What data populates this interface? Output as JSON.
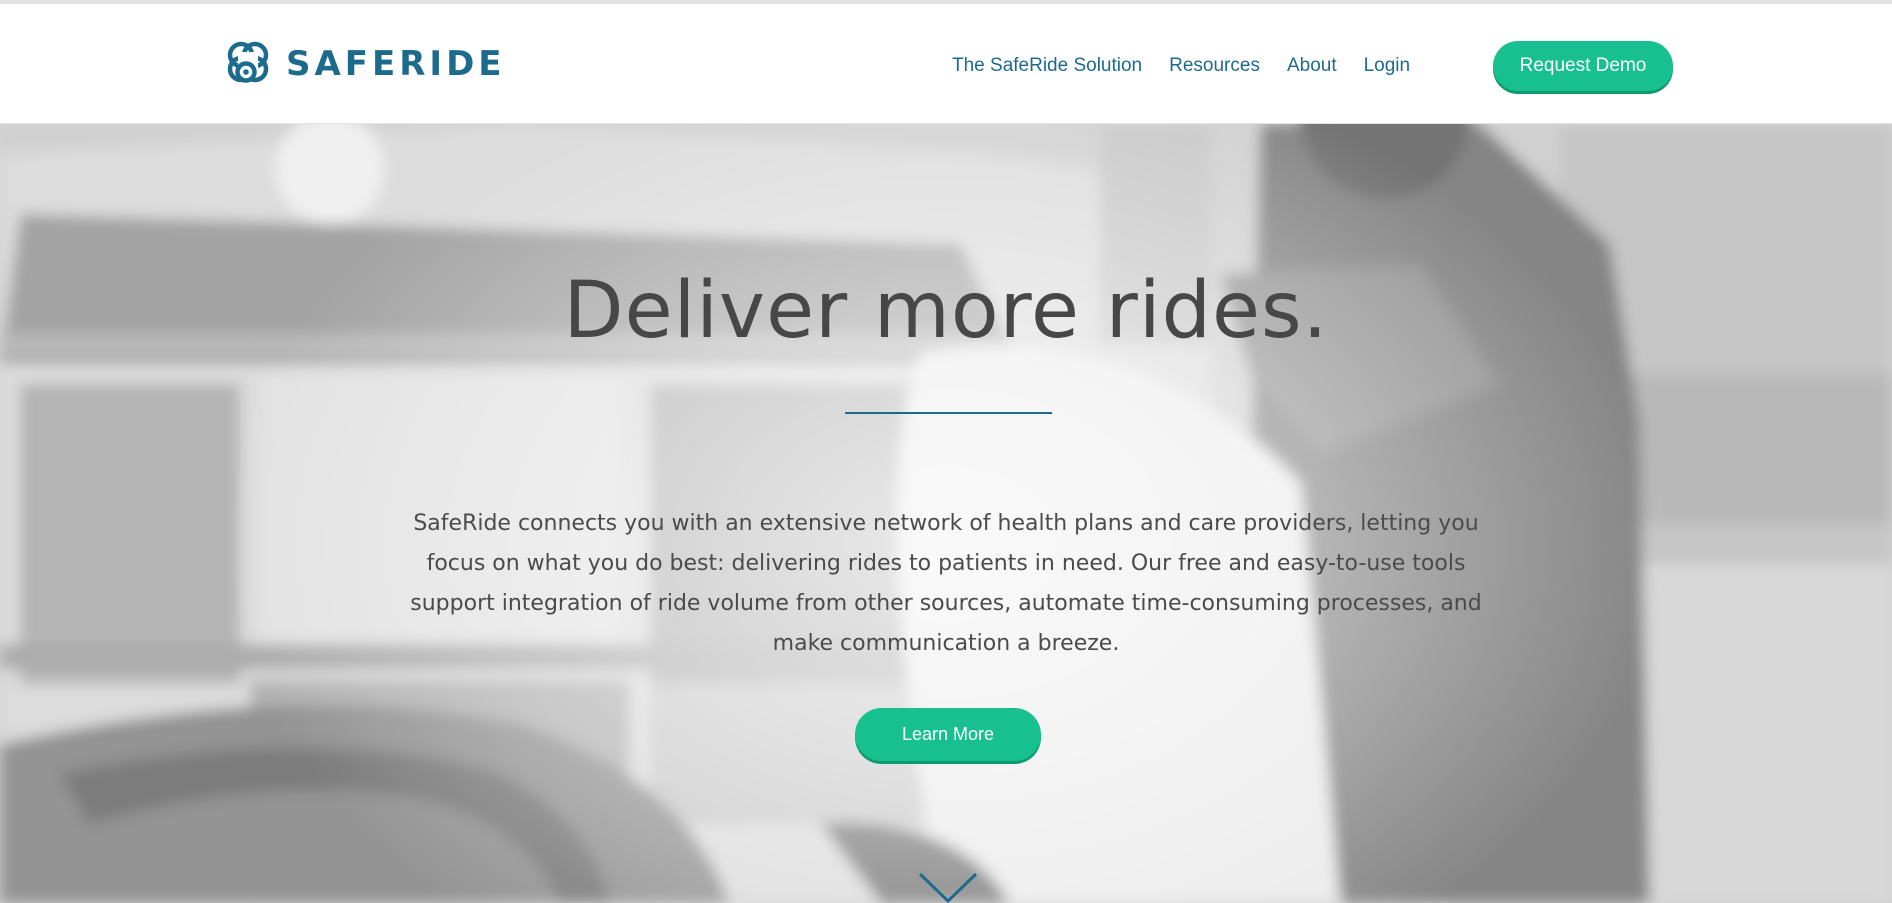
{
  "brand": {
    "name": "SAFERIDE",
    "accent_color": "#1d6b8c",
    "button_color": "#17c08e",
    "logo_icon": "saferide-logo-mark-icon"
  },
  "nav": {
    "items": [
      {
        "label": "The SafeRide Solution"
      },
      {
        "label": "Resources"
      },
      {
        "label": "About"
      },
      {
        "label": "Login"
      }
    ],
    "cta_label": "Request Demo"
  },
  "hero": {
    "title": "Deliver more rides.",
    "body": "SafeRide connects you with an extensive network of health plans and care providers, letting you focus on what you do best: delivering rides to patients in need. Our free and easy-to-use tools support integration of ride volume from other sources, automate time-consuming processes, and make communication a breeze.",
    "button_label": "Learn More",
    "scroll_icon": "chevron-down-icon"
  }
}
